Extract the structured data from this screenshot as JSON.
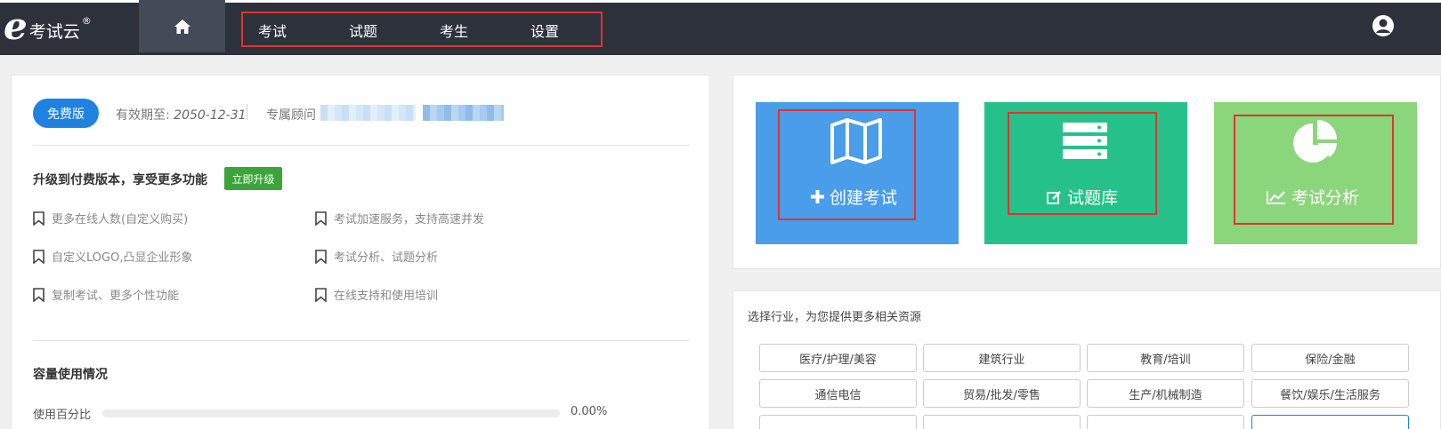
{
  "header": {
    "logo_letter": "e",
    "logo_text": "考试云",
    "logo_reg": "®",
    "nav": [
      "考试",
      "试题",
      "考生",
      "设置"
    ]
  },
  "account": {
    "edition_badge": "免费版",
    "expire_label": "有效期至:",
    "expire_value": "2050-12-31",
    "advisor_label": "专属顾问"
  },
  "upgrade": {
    "title": "升级到付费版本，享受更多功能",
    "button": "立即升级",
    "features": [
      "更多在线人数(自定义购买)",
      "考试加速服务，支持高速并发",
      "自定义LOGO,凸显企业形象",
      "考试分析、试题分析",
      "复制考试、更多个性功能",
      "在线支持和使用培训"
    ]
  },
  "capacity": {
    "title": "容量使用情况",
    "usage_label": "使用百分比",
    "usage_value": "0.00%",
    "usage_fraction": 0.0
  },
  "tiles": [
    {
      "label": "创建考试",
      "icon": "map-icon",
      "color": "#4a9de8"
    },
    {
      "label": "试题库",
      "icon": "server-icon",
      "color": "#26c18a"
    },
    {
      "label": "考试分析",
      "icon": "pie-chart-icon",
      "color": "#8bd67a"
    }
  ],
  "industry": {
    "title": "选择行业，为您提供更多相关资源",
    "options": [
      "医疗/护理/美容",
      "建筑行业",
      "教育/培训",
      "保险/金融",
      "通信电信",
      "贸易/批发/零售",
      "生产/机械制造",
      "餐饮/娱乐/生活服务"
    ]
  },
  "colors": {
    "topbar": "#2c313c",
    "primary": "#1e82e0",
    "upgrade": "#3ba53b",
    "highlight": "#e23232"
  }
}
